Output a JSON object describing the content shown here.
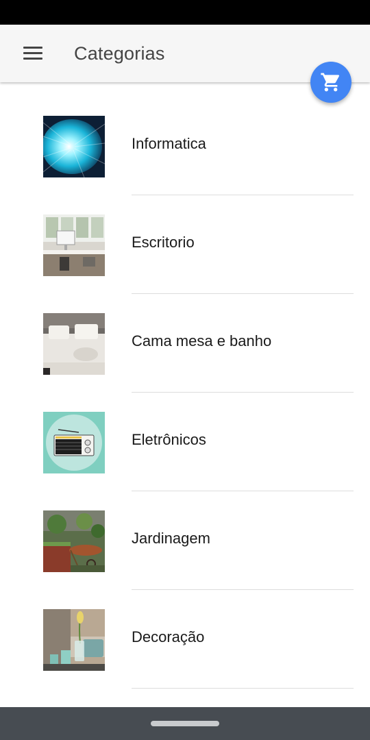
{
  "header": {
    "title": "Categorias",
    "menu_icon": "menu-icon",
    "cart_icon": "cart-icon"
  },
  "colors": {
    "fab": "#4285f4",
    "app_bar": "#f6f6f6",
    "nav_bar": "#474c52",
    "status_bar": "#000000"
  },
  "categories": [
    {
      "label": "Informatica",
      "image": "binary-tunnel-image"
    },
    {
      "label": "Escritorio",
      "image": "office-desk-image"
    },
    {
      "label": "Cama mesa e banho",
      "image": "bedroom-image"
    },
    {
      "label": "Eletrônicos",
      "image": "radio-image"
    },
    {
      "label": "Jardinagem",
      "image": "garden-image"
    },
    {
      "label": "Decoração",
      "image": "decor-vase-image"
    }
  ]
}
